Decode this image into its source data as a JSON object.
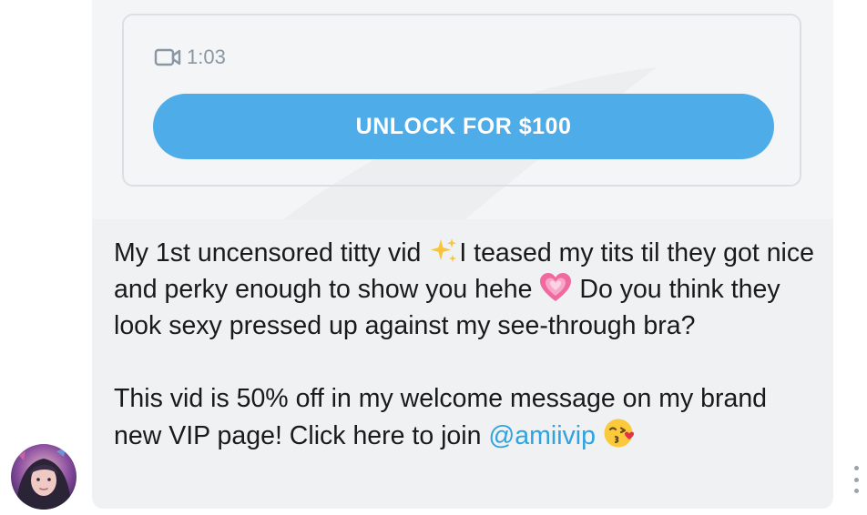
{
  "message": {
    "media": {
      "duration": "1:03",
      "duration_icon": "video-camera-icon",
      "unlock_label": "UNLOCK FOR $100"
    },
    "text": {
      "para1_part1": "My 1st uncensored titty vid ",
      "para1_emoji1": "sparkles",
      "para1_part2": "I teased my tits til they got nice and perky enough to show you hehe ",
      "para1_emoji2": "growing-heart",
      "para1_part3": " Do you think they look sexy pressed up against my see-through bra?",
      "para2_part1": "This vid is 50% off in my welcome message on my brand new VIP page! Click here to join ",
      "para2_mention": "@amiivip",
      "para2_emoji": "face-blowing-a-kiss"
    }
  },
  "sender": {
    "avatar_icon": "avatar"
  },
  "actions": {
    "more_icon": "more-vertical-icon"
  },
  "colors": {
    "bubble_bg": "#eff1f3",
    "media_bg": "#f4f5f6",
    "unlock_button": "#4eade8",
    "mention": "#2fa3e0",
    "muted_text": "#8a96a3"
  }
}
